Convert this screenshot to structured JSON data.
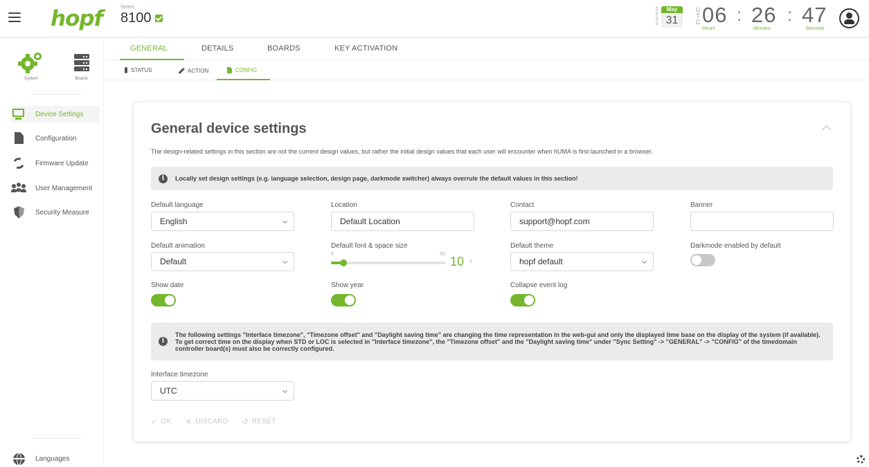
{
  "header": {
    "logo": "hopf",
    "series_label": "Series",
    "series_value": "8100",
    "date": {
      "year_vertical": "2023",
      "month": "May",
      "day": "31"
    },
    "utc_vertical": "UTC",
    "clock": {
      "hours": "06",
      "minutes": "26",
      "seconds": "47",
      "hours_label": "Hours",
      "minutes_label": "Minutes",
      "seconds_label": "Seconds",
      "separator": ":"
    }
  },
  "sidebar": {
    "top": [
      {
        "label": "System",
        "icon": "gears-icon",
        "active": true
      },
      {
        "label": "Boards",
        "icon": "server-icon",
        "active": false
      }
    ],
    "items": [
      {
        "label": "Device Settings",
        "icon": "monitor-icon",
        "active": true
      },
      {
        "label": "Configuration",
        "icon": "file-icon",
        "active": false
      },
      {
        "label": "Firmware Update",
        "icon": "refresh-icon",
        "active": false
      },
      {
        "label": "User Management",
        "icon": "users-icon",
        "active": false
      },
      {
        "label": "Security Measure",
        "icon": "shield-icon",
        "active": false
      }
    ],
    "bottom": {
      "label": "Languages",
      "icon": "globe-icon"
    }
  },
  "tabs": [
    "GENERAL",
    "DETAILS",
    "BOARDS",
    "KEY ACTIVATION"
  ],
  "subtabs": [
    "STATUS",
    "ACTION",
    "CONFIG"
  ],
  "card": {
    "title": "General device settings",
    "description": "The design-related settings in this section are not the current design values, but rather the initial design values that each user will encounter when hUMA is first launched in a browser.",
    "info1": "Locally set design settings (e.g. language selection, design page, darkmode switcher) always overrule the default values in this section!",
    "info2": "The following settings \"Interface timezone\", \"Timezone offset\" and \"Daylight saving time\" are changing the time representation in the web-gui and only the displayed time base on the display of the system (if available). To get correct time on the display when STD or LOC is selected in \"Interface timezone\", the \"Timezone offset\" and the \"Daylight saving time\" under \"Sync Setting\" -> \"GENERAL\" -> \"CONFIG\" of the timedomain controller board(s) must also be correctly configured.",
    "fields": {
      "default_language": {
        "label": "Default language",
        "value": "English"
      },
      "location": {
        "label": "Location",
        "value": "Default Location"
      },
      "contact": {
        "label": "Contact",
        "value": "support@hopf.com"
      },
      "banner": {
        "label": "Banner",
        "value": ""
      },
      "default_animation": {
        "label": "Default animation",
        "value": "Default"
      },
      "font_size": {
        "label": "Default font & space size",
        "min": "5",
        "max": "50",
        "value": "10",
        "fraction": 0.11
      },
      "default_theme": {
        "label": "Default theme",
        "value": "hopf default"
      },
      "darkmode": {
        "label": "Darkmode enabled by default",
        "on": false
      },
      "show_date": {
        "label": "Show date",
        "on": true
      },
      "show_year": {
        "label": "Show year",
        "on": true
      },
      "collapse_log": {
        "label": "Collapse event log",
        "on": true
      },
      "interface_timezone": {
        "label": "Interface timezone",
        "value": "UTC"
      }
    },
    "actions": {
      "ok": "OK",
      "discard": "DISCARD",
      "reset": "RESET"
    }
  },
  "colors": {
    "accent": "#74b72e",
    "text": "#333333",
    "muted": "#c8c8c8"
  }
}
